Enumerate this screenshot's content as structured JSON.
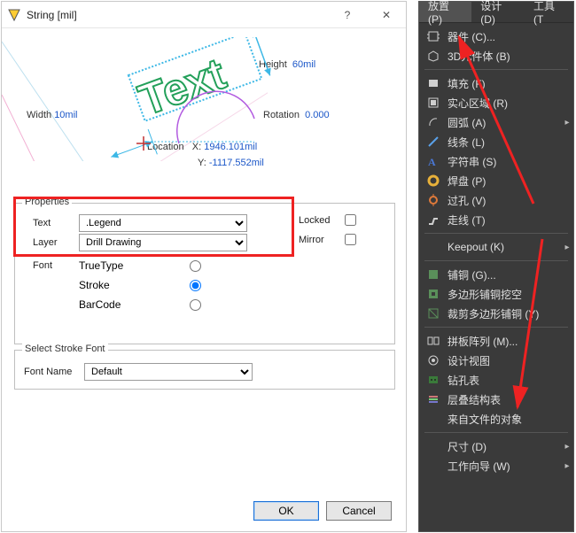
{
  "dialog": {
    "title": "String  [mil]",
    "help_glyph": "?",
    "close_glyph": "✕",
    "preview_text": "Text",
    "dims": {
      "height_label": "Height",
      "height_value": "60mil",
      "width_label": "Width",
      "width_value": "10mil",
      "rotation_label": "Rotation",
      "rotation_value": "0.000",
      "location_label": "Location",
      "xy_x_label": "X:",
      "xy_x_value": "1946.101mil",
      "xy_y_label": "Y:",
      "xy_y_value": "-1117.552mil"
    },
    "properties": {
      "group_title": "Properties",
      "text_label": "Text",
      "text_value": ".Legend",
      "layer_label": "Layer",
      "layer_value": "Drill Drawing",
      "locked_label": "Locked",
      "mirror_label": "Mirror",
      "font_label": "Font",
      "font_options": {
        "truetype": "TrueType",
        "stroke": "Stroke",
        "barcode": "BarCode"
      }
    },
    "stroke_font": {
      "group_title": "Select Stroke Font",
      "fontname_label": "Font Name",
      "fontname_value": "Default"
    },
    "buttons": {
      "ok": "OK",
      "cancel": "Cancel"
    }
  },
  "menu": {
    "tabs": {
      "place": "放置 (P)",
      "design": "设计 (D)",
      "tools": "工具 (T"
    },
    "items": [
      {
        "icon": "chip-icon",
        "label": "器件 (C)...",
        "sub": false
      },
      {
        "icon": "cube-icon",
        "label": "3D元件体 (B)",
        "sub": false
      },
      {
        "sep": true
      },
      {
        "icon": "fill-icon",
        "label": "填充 (F)",
        "sub": false
      },
      {
        "icon": "region-icon",
        "label": "实心区域 (R)",
        "sub": false
      },
      {
        "icon": "arc-icon",
        "label": "圆弧 (A)",
        "sub": true
      },
      {
        "icon": "line-icon",
        "label": "线条 (L)",
        "sub": false
      },
      {
        "icon": "string-icon",
        "label": "字符串 (S)",
        "sub": false
      },
      {
        "icon": "pad-icon",
        "label": "焊盘 (P)",
        "sub": false
      },
      {
        "icon": "via-icon",
        "label": "过孔 (V)",
        "sub": false
      },
      {
        "icon": "route-icon",
        "label": "走线 (T)",
        "sub": false
      },
      {
        "sep": true
      },
      {
        "icon": "",
        "label": "Keepout (K)",
        "sub": true
      },
      {
        "sep": true
      },
      {
        "icon": "pour-icon",
        "label": "铺铜 (G)...",
        "sub": false
      },
      {
        "icon": "cutout-icon",
        "label": "多边形铺铜挖空",
        "sub": false
      },
      {
        "icon": "cutpoly-icon",
        "label": "裁剪多边形铺铜 (Y)",
        "sub": false
      },
      {
        "sep": true
      },
      {
        "icon": "panel-icon",
        "label": "拼板阵列 (M)...",
        "sub": false
      },
      {
        "icon": "view-icon",
        "label": "设计视图",
        "sub": false
      },
      {
        "icon": "drill-icon",
        "label": "钻孔表",
        "sub": false
      },
      {
        "icon": "stack-icon",
        "label": "层叠结构表",
        "sub": false
      },
      {
        "icon": "",
        "label": "来自文件的对象",
        "sub": false
      },
      {
        "sep": true
      },
      {
        "icon": "",
        "label": "尺寸 (D)",
        "sub": true
      },
      {
        "icon": "",
        "label": "工作向导 (W)",
        "sub": true
      }
    ],
    "submenu_arrow": "▸"
  }
}
